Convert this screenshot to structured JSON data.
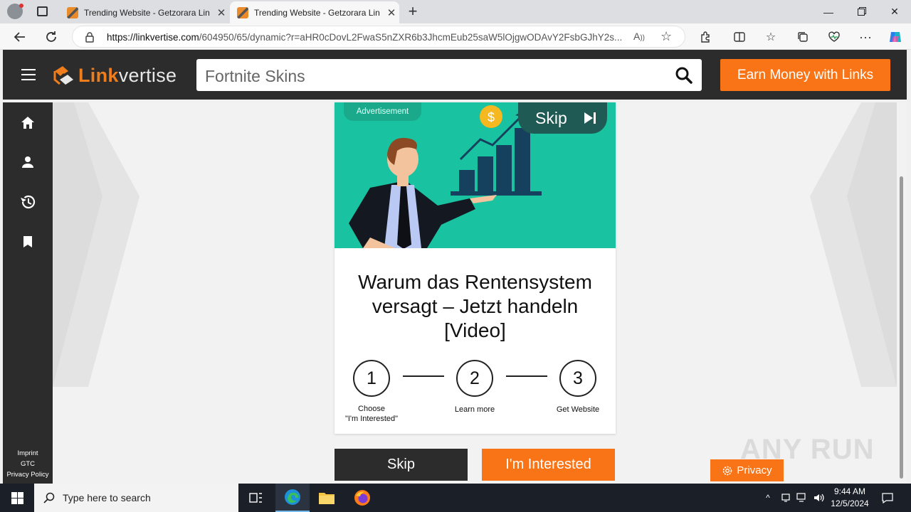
{
  "browser": {
    "tabs": [
      {
        "title": "Trending Website - Getzorara Lin",
        "active": false
      },
      {
        "title": "Trending Website - Getzorara Lin",
        "active": true
      }
    ],
    "url_host": "https://linkvertise.com",
    "url_path": "/604950/65/dynamic?r=aHR0cDovL2FwaS5nZXR6b3JhcmEub25saW5lOjgwODAvY2FsbGJhY2s..."
  },
  "header": {
    "logo_part1": "Link",
    "logo_part2": "vertise",
    "search_value": "Fortnite Skins",
    "earn_label": "Earn Money with Links"
  },
  "sidebar": {
    "items": [
      {
        "icon": "home-icon"
      },
      {
        "icon": "user-icon"
      },
      {
        "icon": "history-icon"
      },
      {
        "icon": "bookmark-icon"
      }
    ],
    "footer": {
      "imprint": "Imprint",
      "gtc": "GTC",
      "privacy": "Privacy Policy"
    }
  },
  "ad": {
    "badge": "Advertisement",
    "skip_label": "Skip",
    "headline": "Warum das Rentensystem versagt – Jetzt handeln [Video]",
    "steps": [
      {
        "num": "1",
        "label_line1": "Choose",
        "label_line2": "\"I'm Interested\""
      },
      {
        "num": "2",
        "label_line1": "Learn more",
        "label_line2": ""
      },
      {
        "num": "3",
        "label_line1": "Get Website",
        "label_line2": ""
      }
    ]
  },
  "actions": {
    "skip": "Skip",
    "interested": "I'm Interested"
  },
  "privacy_button": "Privacy",
  "watermark": "ANY RUN",
  "taskbar": {
    "search_placeholder": "Type here to search",
    "time": "9:44 AM",
    "date": "12/5/2024"
  },
  "colors": {
    "accent": "#f97416",
    "header": "#2c2c2c",
    "ad_bg": "#19c3a1"
  }
}
